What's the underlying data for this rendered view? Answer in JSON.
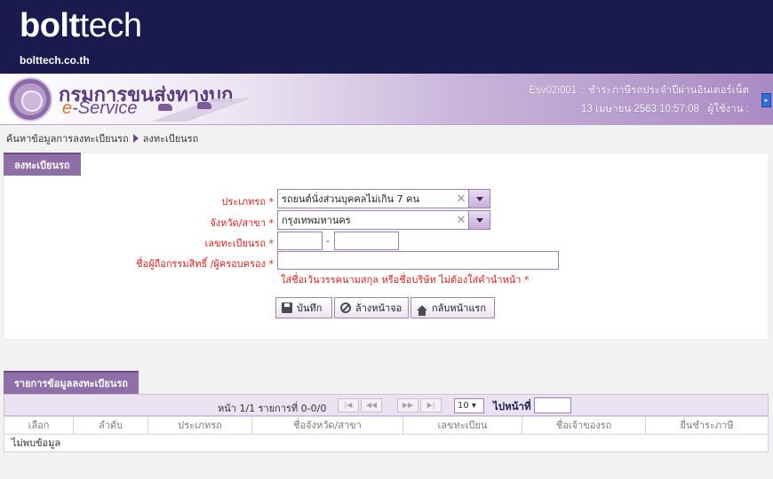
{
  "brand": {
    "logo_bold": "bolt",
    "logo_light": "tech",
    "domain": "bolttech.co.th"
  },
  "header": {
    "dept_name": "กรมการขนส่งทางบก",
    "eservice_prefix": "e",
    "eservice_rest": "-Service",
    "system_code": "Esv02i001 :: ชำระภาษีรถประจำปีผ่านอินเตอร์เน็ต",
    "datetime": "13 เมษายน 2563 10:57:08",
    "user_label": "ผู้ใช้งาน :"
  },
  "breadcrumb": {
    "parent": "ค้นหาข้อมูลการลงทะเบียนรถ",
    "current": "ลงทะเบียนรถ"
  },
  "form": {
    "title": "ลงทะเบียนรถ",
    "vehicle_type_label": "ประเภทรถ *",
    "vehicle_type_value": "รถยนต์นั่งส่วนบุคคลไม่เกิน 7 คน",
    "province_label": "จังหวัด/สาขา *",
    "province_value": "กรุงเทพมหานคร",
    "plate_label": "เลขทะเบียนรถ *",
    "plate_part1": "",
    "plate_separator": "-",
    "plate_part2": "",
    "owner_label": "ชื่อผู้ถือกรรมสิทธิ์ /ผู้ครอบครอง *",
    "owner_value": "",
    "owner_hint": "ใส่ชื่อเว้นวรรคนามสกุล หรือชื่อบริษัท ไม่ต้องใส่คำนำหน้า *",
    "save_label": "บันทึก",
    "clear_label": "ล้างหน้าจอ",
    "home_label": "กลับหน้าแรก"
  },
  "results": {
    "title": "รายการข้อมูลลงทะเบียนรถ",
    "pager_info": "หน้า 1/1 รายการที่ 0-0/0",
    "page_size": "10",
    "goto_label": "ไปหน้าที่",
    "columns": [
      "เลือก",
      "ลำดับ",
      "ประเภทรถ",
      "ชื่อจังหวัด/สาขา",
      "เลขทะเบียน",
      "ชื่อเจ้าของรถ",
      "ยื่นชำระภาษี"
    ],
    "empty_text": "ไม่พบข้อมูล"
  },
  "colors": {
    "brand_navy": "#1b1a4f",
    "accent_purple": "#8e6fa8",
    "required_red": "#e0201b"
  },
  "icons": [
    "save-icon",
    "clear-icon",
    "home-icon",
    "chevron-down-icon",
    "clear-x-icon",
    "first-page-icon",
    "prev-page-icon",
    "next-page-icon",
    "last-page-icon"
  ]
}
